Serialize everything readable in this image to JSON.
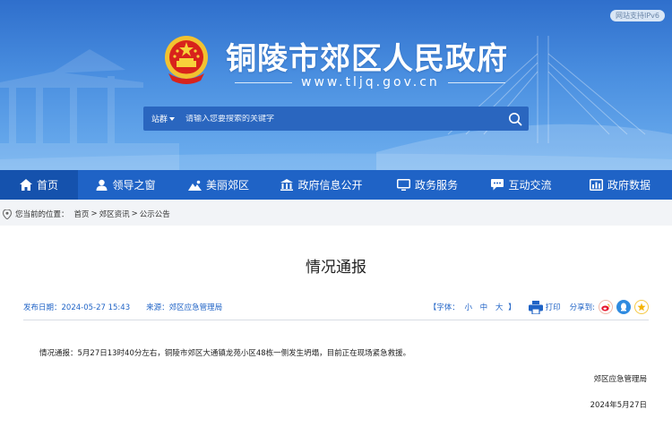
{
  "header": {
    "ipv6_badge": "网站支持IPv6",
    "site_title": "铜陵市郊区人民政府",
    "site_url": "www.tljq.gov.cn"
  },
  "search": {
    "scope": "站群",
    "placeholder": "请输入您要搜索的关键字"
  },
  "nav": [
    {
      "label": "首页",
      "icon": "home-icon"
    },
    {
      "label": "领导之窗",
      "icon": "user-icon"
    },
    {
      "label": "美丽郊区",
      "icon": "landscape-icon"
    },
    {
      "label": "政府信息公开",
      "icon": "building-icon"
    },
    {
      "label": "政务服务",
      "icon": "monitor-icon"
    },
    {
      "label": "互动交流",
      "icon": "chat-icon"
    },
    {
      "label": "政府数据",
      "icon": "data-icon"
    }
  ],
  "breadcrumb": {
    "prefix": "您当前的位置：",
    "items": [
      "首页",
      "郊区资讯",
      "公示公告"
    ],
    "separator": ">"
  },
  "article": {
    "title": "情况通报",
    "date_label": "发布日期：2024-05-27 15:43",
    "source_label": "来源：郊区应急管理局",
    "font_prefix": "【字体：",
    "font_small": "小",
    "font_medium": "中",
    "font_large": "大",
    "font_suffix": "】",
    "print_label": "打印",
    "share_label": "分享到:",
    "body": "情况通报：5月27日13时40分左右，铜陵市郊区大通镇龙苑小区48栋一侧发生坍塌，目前正在现场紧急救援。",
    "sign_org": "郊区应急管理局",
    "sign_date": "2024年5月27日"
  },
  "colors": {
    "nav_bg": "#1f63c6",
    "accent": "#1f63c6",
    "weibo": "#e6162d",
    "qzone": "#2f8be0",
    "star": "#f5b400"
  }
}
